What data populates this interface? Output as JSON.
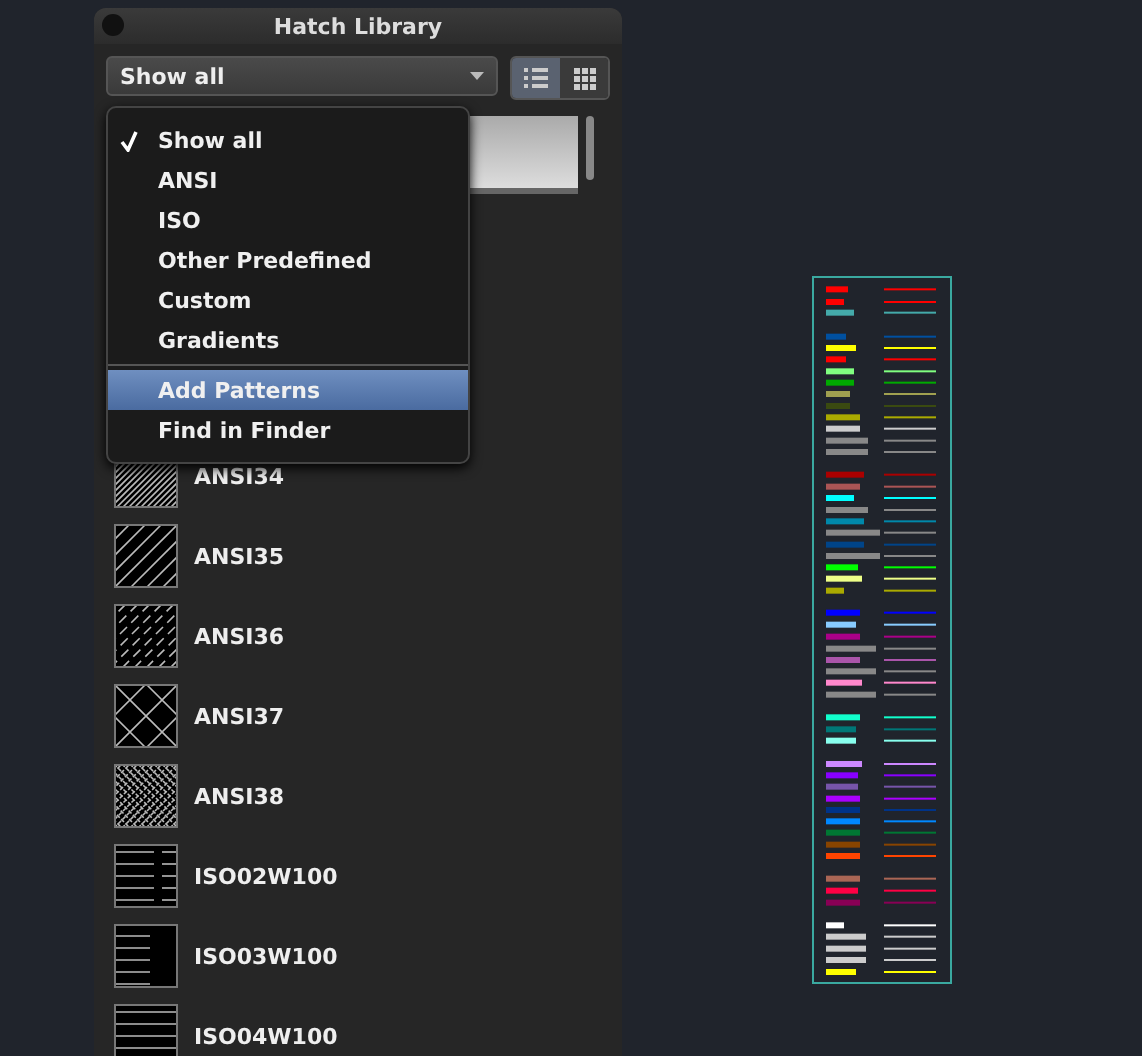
{
  "panel": {
    "title": "Hatch Library"
  },
  "filter": {
    "value": "Show all"
  },
  "view_buttons": [
    {
      "kind": "list",
      "selected": true
    },
    {
      "kind": "grid",
      "selected": false
    }
  ],
  "menu": [
    {
      "label": "Show all",
      "checked": true,
      "selected": false,
      "kind": "item"
    },
    {
      "label": "ANSI",
      "checked": false,
      "selected": false,
      "kind": "item"
    },
    {
      "label": "ISO",
      "checked": false,
      "selected": false,
      "kind": "item"
    },
    {
      "label": "Other Predefined",
      "checked": false,
      "selected": false,
      "kind": "item"
    },
    {
      "label": "Custom",
      "checked": false,
      "selected": false,
      "kind": "item"
    },
    {
      "label": "Gradients",
      "checked": false,
      "selected": false,
      "kind": "item"
    },
    {
      "kind": "separator"
    },
    {
      "label": "Add Patterns",
      "checked": false,
      "selected": true,
      "kind": "item"
    },
    {
      "label": "Find in Finder",
      "checked": false,
      "selected": false,
      "kind": "item"
    }
  ],
  "patterns": [
    {
      "name": "ANSI34",
      "kind": "dense-diagonal"
    },
    {
      "name": "ANSI35",
      "kind": "diagonal"
    },
    {
      "name": "ANSI36",
      "kind": "dashed-diagonal"
    },
    {
      "name": "ANSI37",
      "kind": "diamond"
    },
    {
      "name": "ANSI38",
      "kind": "crosshatch"
    },
    {
      "name": "ISO02W100",
      "kind": "dash-lines"
    },
    {
      "name": "ISO03W100",
      "kind": "short-lines"
    },
    {
      "name": "ISO04W100",
      "kind": "lines"
    }
  ]
}
